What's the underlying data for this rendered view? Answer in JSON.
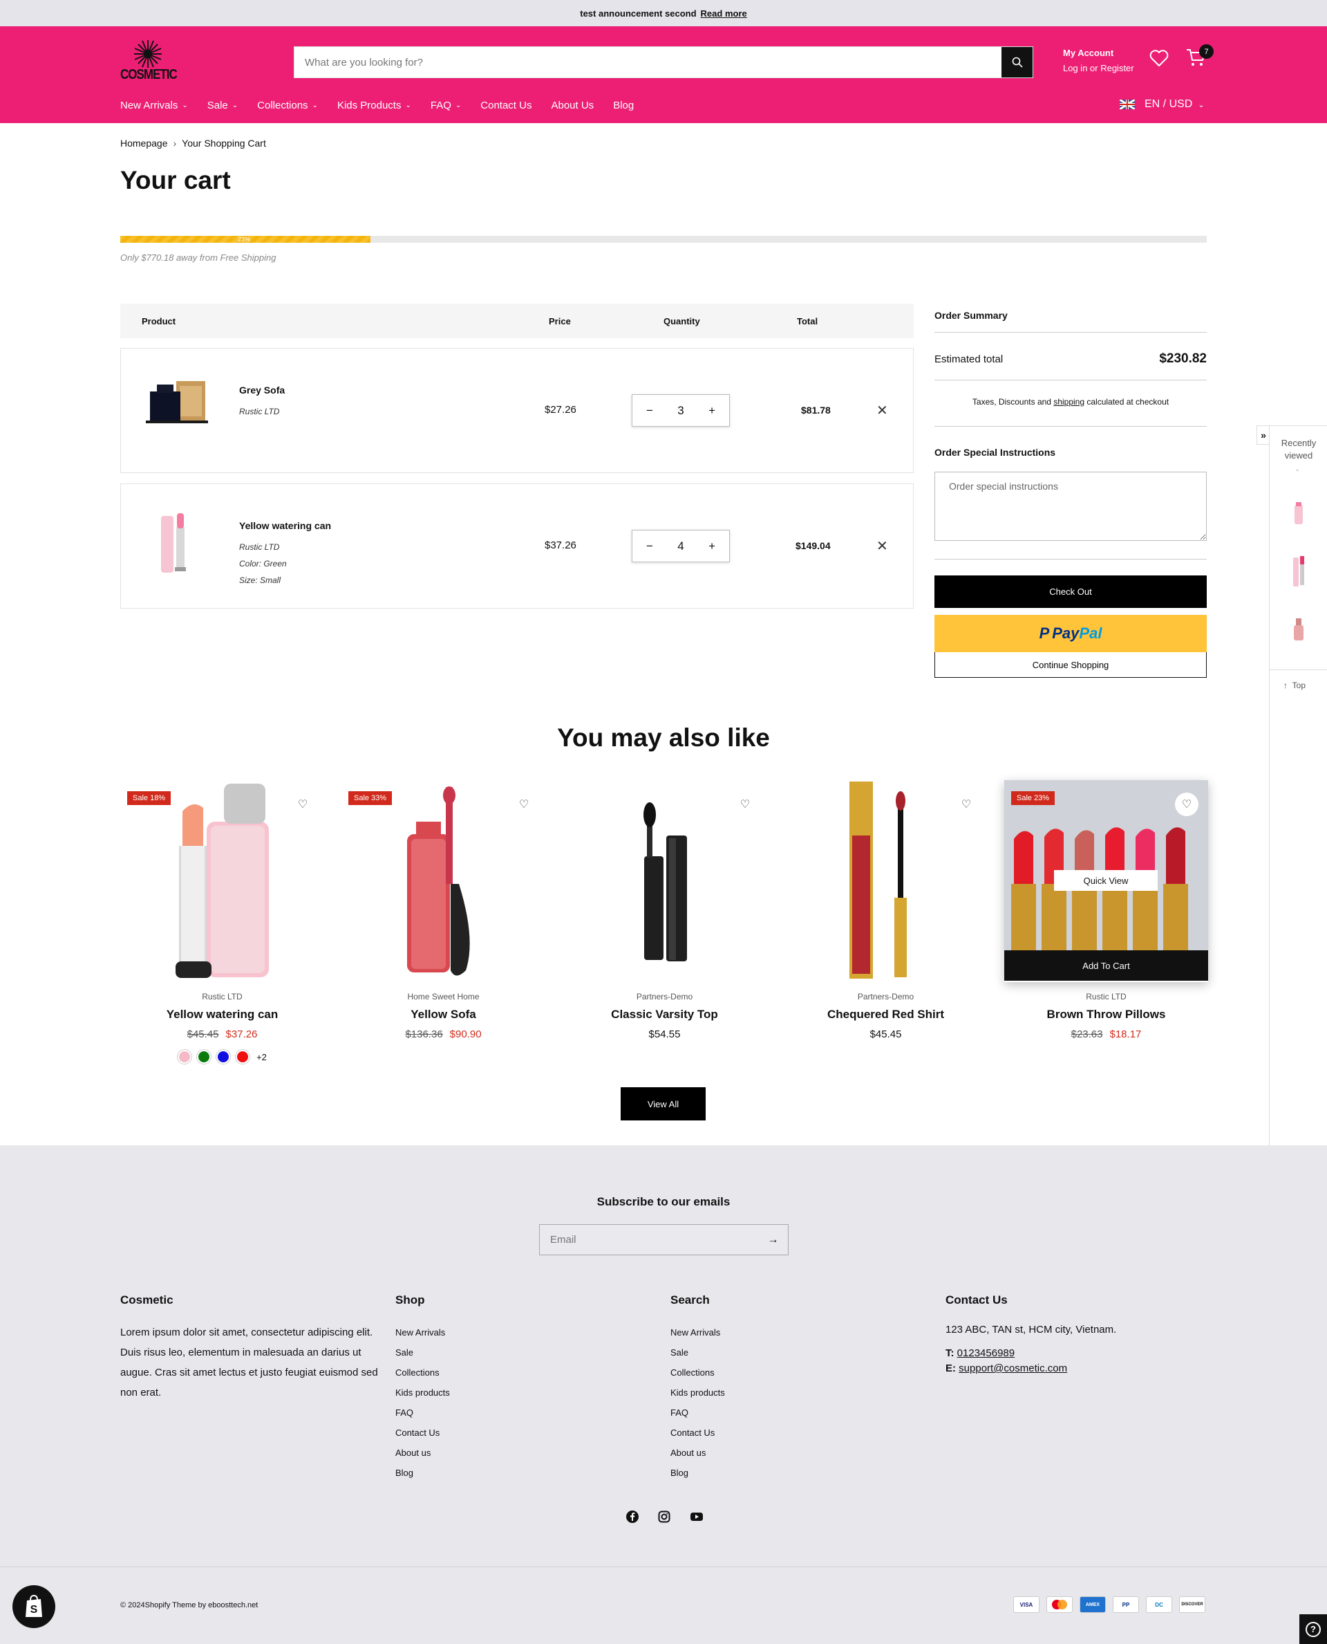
{
  "announcement": {
    "text": "test announcement second",
    "link": "Read more"
  },
  "header": {
    "logo_text": "COSMETIC",
    "search_placeholder": "What are you looking for?",
    "account_title": "My Account",
    "account_sub": "Log in or Register",
    "cart_count": "7",
    "nav": [
      "New Arrivals",
      "Sale",
      "Collections",
      "Kids Products",
      "FAQ",
      "Contact Us",
      "About Us",
      "Blog"
    ],
    "lang_currency": "EN / USD"
  },
  "breadcrumb": {
    "home": "Homepage",
    "current": "Your Shopping Cart"
  },
  "page_title": "Your cart",
  "shipping": {
    "progress": 0.23,
    "pct_label": "23%",
    "note": "Only $770.18 away from Free Shipping"
  },
  "table_headers": {
    "product": "Product",
    "price": "Price",
    "quantity": "Quantity",
    "total": "Total"
  },
  "cart_items": [
    {
      "name": "Grey Sofa",
      "vendor": "Rustic LTD",
      "color": "",
      "size": "",
      "price": "$27.26",
      "qty": "3",
      "total": "$81.78"
    },
    {
      "name": "Yellow watering can",
      "vendor": "Rustic LTD",
      "color": "Color: Green",
      "size": "Size: Small",
      "price": "$37.26",
      "qty": "4",
      "total": "$149.04"
    }
  ],
  "summary": {
    "title": "Order Summary",
    "est_label": "Estimated total",
    "est_value": "$230.82",
    "tax_pre": "Taxes, Discounts and ",
    "tax_link": "shipping",
    "tax_post": " calculated at checkout",
    "instr_title": "Order Special Instructions",
    "instr_placeholder": "Order special instructions",
    "checkout": "Check Out",
    "paypal_a": "Pay",
    "paypal_b": "Pal",
    "continue": "Continue Shopping"
  },
  "recently_viewed": {
    "title": "Recently viewed",
    "top": "Top"
  },
  "ymal_title": "You may also like",
  "products": [
    {
      "sale": "Sale 18%",
      "vendor": "Rustic LTD",
      "name": "Yellow watering can",
      "old": "$45.45",
      "price": "$37.26",
      "more": "+2"
    },
    {
      "sale": "Sale 33%",
      "vendor": "Home Sweet Home",
      "name": "Yellow Sofa",
      "old": "$136.36",
      "price": "$90.90"
    },
    {
      "sale": "",
      "vendor": "Partners-Demo",
      "name": "Classic Varsity Top",
      "old": "",
      "price": "$54.55"
    },
    {
      "sale": "",
      "vendor": "Partners-Demo",
      "name": "Chequered Red Shirt",
      "old": "",
      "price": "$45.45"
    },
    {
      "sale": "Sale 23%",
      "vendor": "Rustic LTD",
      "name": "Brown Throw Pillows",
      "old": "$23.63",
      "price": "$18.17",
      "quick": "Quick View",
      "add": "Add To Cart"
    }
  ],
  "swatch_colors": [
    "#f6b9c8",
    "#0a7a0a",
    "#1010e0",
    "#ee0f0f"
  ],
  "view_all": "View All",
  "footer": {
    "subscribe_title": "Subscribe to our emails",
    "email_placeholder": "Email",
    "col1_title": "Cosmetic",
    "col1_text": "Lorem ipsum dolor sit amet, consectetur adipiscing elit. Duis risus leo, elementum in malesuada an darius ut augue. Cras sit amet lectus et justo feugiat euismod sed non erat.",
    "col2_title": "Shop",
    "col2_links": [
      "New Arrivals",
      "Sale",
      "Collections",
      "Kids products",
      "FAQ",
      "Contact Us",
      "About us",
      "Blog"
    ],
    "col3_title": "Search",
    "col3_links": [
      "New Arrivals",
      "Sale",
      "Collections",
      "Kids products",
      "FAQ",
      "Contact Us",
      "About us",
      "Blog"
    ],
    "col4_title": "Contact Us",
    "address": "123 ABC, TAN st, HCM city, Vietnam.",
    "tel_label": "T:",
    "tel": "0123456989",
    "email_label": "E:",
    "email": "support@cosmetic.com",
    "copyright": "© 2024Shopify Theme by eboosttech.net",
    "payments": [
      "VISA",
      "MC",
      "AMEX",
      "PP",
      "DC",
      "DISCOVER"
    ]
  },
  "colors": {
    "brand": "#ec1f74",
    "sale": "#d12a1c",
    "paypal": "#ffc43a"
  }
}
